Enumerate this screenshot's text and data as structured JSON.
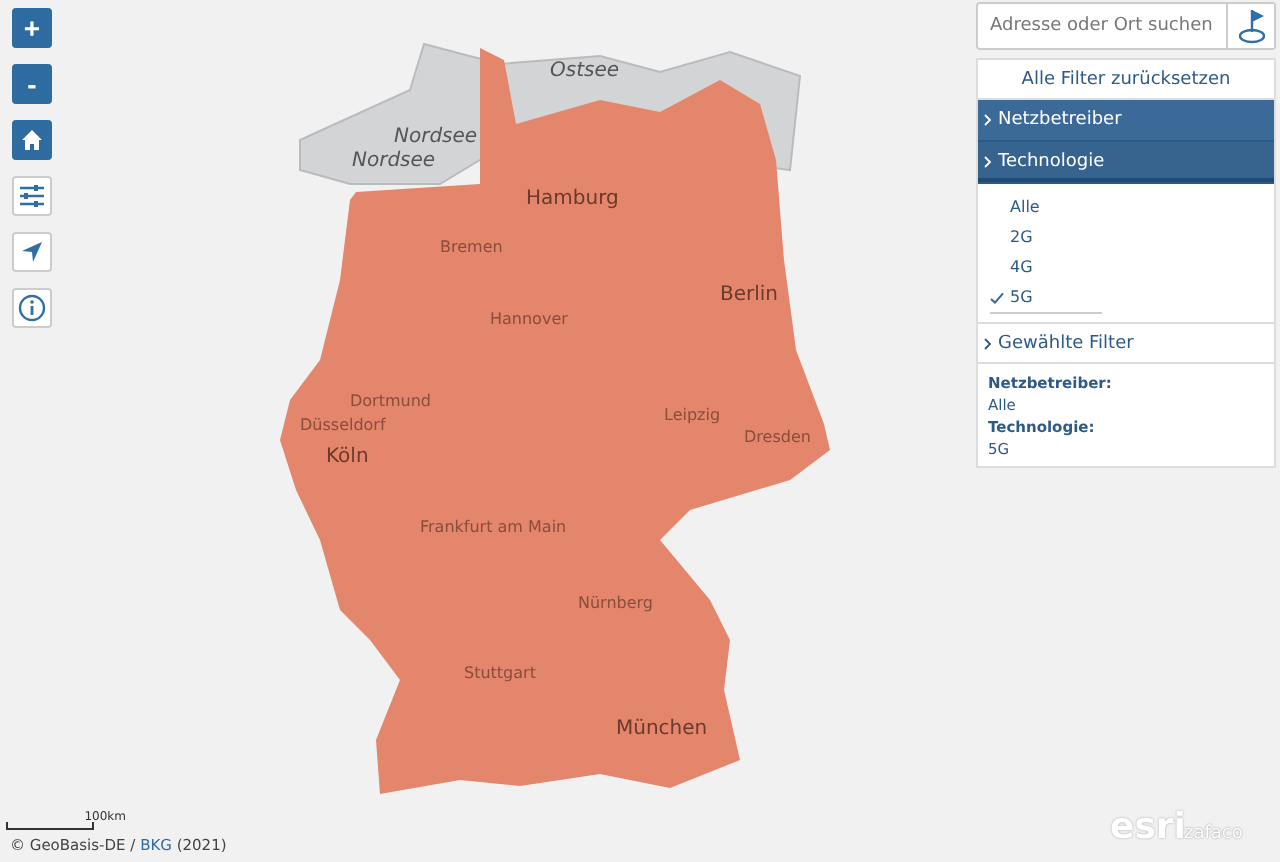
{
  "map_controls": [
    {
      "kind": "zoom-in",
      "label": "+"
    },
    {
      "kind": "zoom-out",
      "label": "-"
    },
    {
      "kind": "home"
    },
    {
      "kind": "filter"
    },
    {
      "kind": "locate"
    },
    {
      "kind": "info"
    }
  ],
  "search": {
    "placeholder": "Adresse oder Ort suchen"
  },
  "filter_panel": {
    "reset": "Alle Filter zurücksetzen",
    "sections": [
      {
        "label": "Netzbetreiber",
        "expanded": false
      },
      {
        "label": "Technologie",
        "expanded": true
      }
    ],
    "options": [
      {
        "label": "Alle",
        "selected": false
      },
      {
        "label": "2G",
        "selected": false
      },
      {
        "label": "4G",
        "selected": false
      },
      {
        "label": "5G",
        "selected": true
      }
    ],
    "chosen_header": "Gewählte Filter",
    "chosen": [
      {
        "key": "Netzbetreiber:",
        "value": "Alle"
      },
      {
        "key": "Technologie:",
        "value": "5G"
      }
    ]
  },
  "map_labels": [
    {
      "text": "Nordsee",
      "kind": "sea"
    },
    {
      "text": "Nordsee",
      "kind": "sea"
    },
    {
      "text": "Ostsee",
      "kind": "sea"
    },
    {
      "text": "Hamburg",
      "kind": "city"
    },
    {
      "text": "Bremen",
      "kind": "town"
    },
    {
      "text": "Hannover",
      "kind": "town"
    },
    {
      "text": "Berlin",
      "kind": "city"
    },
    {
      "text": "Dortmund",
      "kind": "town"
    },
    {
      "text": "Düsseldorf",
      "kind": "town"
    },
    {
      "text": "Köln",
      "kind": "city"
    },
    {
      "text": "Leipzig",
      "kind": "town"
    },
    {
      "text": "Dresden",
      "kind": "town"
    },
    {
      "text": "Frankfurt am Main",
      "kind": "town"
    },
    {
      "text": "Nürnberg",
      "kind": "town"
    },
    {
      "text": "Stuttgart",
      "kind": "town"
    },
    {
      "text": "München",
      "kind": "city"
    }
  ],
  "scale": {
    "label": "100km"
  },
  "attribution": {
    "prefix": "© GeoBasis-DE / ",
    "link": "BKG",
    "suffix": " (2021)"
  },
  "logos": {
    "esri": "esri",
    "partner": "zafaco"
  }
}
